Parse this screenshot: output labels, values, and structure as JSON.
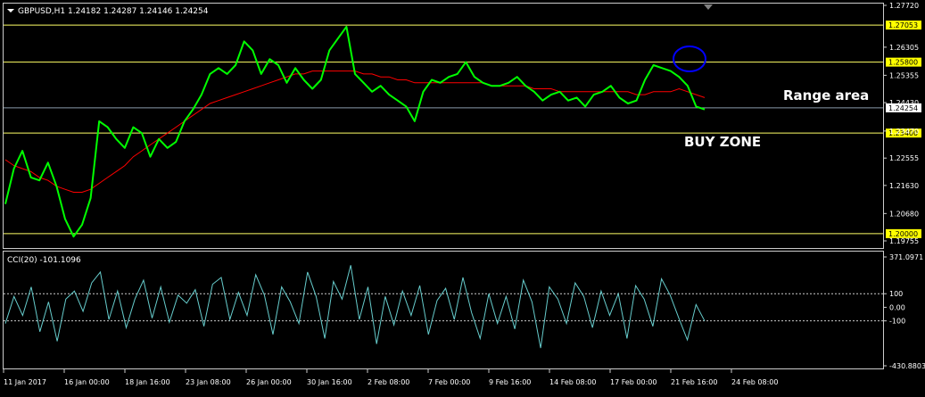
{
  "header": {
    "symbol_line": "GBPUSD,H1  1.24182 1.24287 1.24146 1.24254"
  },
  "annotations": {
    "range_label": "Range area",
    "buy_label": "BUY ZONE"
  },
  "colors": {
    "background": "#000000",
    "price": "#00ff00",
    "moving_average": "#ff0000",
    "level_line": "#ffff66",
    "current_line": "#8899aa",
    "cci": "#66cccc",
    "circle": "#0000ff",
    "text": "#ffffff"
  },
  "chart_data": [
    {
      "type": "line",
      "name": "price-panel",
      "title": "GBPUSD,H1",
      "ohlc": {
        "open": 1.24182,
        "high": 1.24287,
        "low": 1.24146,
        "close": 1.24254
      },
      "ylim": [
        1.19755,
        1.2772
      ],
      "y_ticks": [
        "1.27720",
        "1.26305",
        "1.25355",
        "1.24430",
        "1.23470",
        "1.22555",
        "1.21630",
        "1.20680",
        "1.19755"
      ],
      "level_labels": [
        "1.27053",
        "1.25800",
        "1.24254",
        "1.23400",
        "1.20000"
      ],
      "x_ticks": [
        "11 Jan 2017",
        "16 Jan 00:00",
        "18 Jan 16:00",
        "23 Jan 08:00",
        "26 Jan 00:00",
        "30 Jan 16:00",
        "2 Feb 08:00",
        "7 Feb 00:00",
        "9 Feb 16:00",
        "14 Feb 08:00",
        "17 Feb 00:00",
        "21 Feb 16:00",
        "24 Feb 08:00"
      ],
      "horizontal_lines": [
        1.27053,
        1.258,
        1.24254,
        1.234,
        1.2
      ],
      "series": [
        {
          "values": [
            1.21,
            1.222,
            1.228,
            1.219,
            1.218,
            1.224,
            1.216,
            1.205,
            1.199,
            1.203,
            1.212,
            1.238,
            1.236,
            1.232,
            1.229,
            1.236,
            1.234,
            1.226,
            1.232,
            1.229,
            1.231,
            1.238,
            1.242,
            1.247,
            1.254,
            1.256,
            1.254,
            1.257,
            1.265,
            1.262,
            1.254,
            1.259,
            1.257,
            1.251,
            1.256,
            1.252,
            1.249,
            1.252,
            1.262,
            1.266,
            1.27,
            1.254,
            1.251,
            1.248,
            1.25,
            1.247,
            1.245,
            1.243,
            1.238,
            1.248,
            1.252,
            1.251,
            1.253,
            1.254,
            1.258,
            1.253,
            1.251,
            1.25,
            1.25,
            1.251,
            1.253,
            1.25,
            1.248,
            1.245,
            1.247,
            1.248,
            1.245,
            1.246,
            1.243,
            1.247,
            1.248,
            1.25,
            1.246,
            1.244,
            1.245,
            1.252,
            1.257,
            1.256,
            1.255,
            1.253,
            1.25,
            1.243,
            1.242
          ]
        },
        {
          "values": [
            1.225,
            1.223,
            1.222,
            1.221,
            1.219,
            1.218,
            1.216,
            1.215,
            1.214,
            1.214,
            1.215,
            1.217,
            1.219,
            1.221,
            1.223,
            1.226,
            1.228,
            1.23,
            1.232,
            1.234,
            1.236,
            1.238,
            1.24,
            1.242,
            1.244,
            1.245,
            1.246,
            1.247,
            1.248,
            1.249,
            1.25,
            1.251,
            1.252,
            1.253,
            1.254,
            1.254,
            1.255,
            1.255,
            1.255,
            1.255,
            1.255,
            1.255,
            1.254,
            1.254,
            1.253,
            1.253,
            1.252,
            1.252,
            1.251,
            1.251,
            1.251,
            1.251,
            1.251,
            1.251,
            1.251,
            1.251,
            1.251,
            1.25,
            1.25,
            1.25,
            1.25,
            1.25,
            1.249,
            1.249,
            1.249,
            1.248,
            1.248,
            1.248,
            1.248,
            1.248,
            1.248,
            1.248,
            1.248,
            1.248,
            1.247,
            1.247,
            1.248,
            1.248,
            1.248,
            1.249,
            1.248,
            1.247,
            1.246
          ]
        }
      ]
    },
    {
      "type": "line",
      "name": "cci-panel",
      "title": "CCI(20) -101.1096",
      "ylim": [
        -430.8803,
        371.0971
      ],
      "y_ticks": [
        "371.0971",
        "100",
        "0.00",
        "-100",
        "-430.8803"
      ],
      "dashed_levels": [
        100,
        -100
      ],
      "series": [
        {
          "values": [
            -120,
            80,
            -60,
            150,
            -180,
            40,
            -250,
            60,
            120,
            -30,
            180,
            260,
            -90,
            120,
            -150,
            60,
            200,
            -80,
            150,
            -110,
            90,
            30,
            130,
            -140,
            170,
            220,
            -90,
            110,
            -60,
            240,
            90,
            -200,
            150,
            40,
            -120,
            260,
            80,
            -230,
            190,
            60,
            310,
            -90,
            150,
            -270,
            80,
            -130,
            120,
            -60,
            160,
            -200,
            50,
            140,
            -90,
            220,
            -40,
            -230,
            100,
            -120,
            80,
            -160,
            200,
            40,
            -300,
            150,
            60,
            -120,
            180,
            80,
            -150,
            120,
            -60,
            100,
            -230,
            160,
            60,
            -140,
            210,
            90,
            -80,
            -240,
            20,
            -101
          ]
        }
      ]
    }
  ]
}
